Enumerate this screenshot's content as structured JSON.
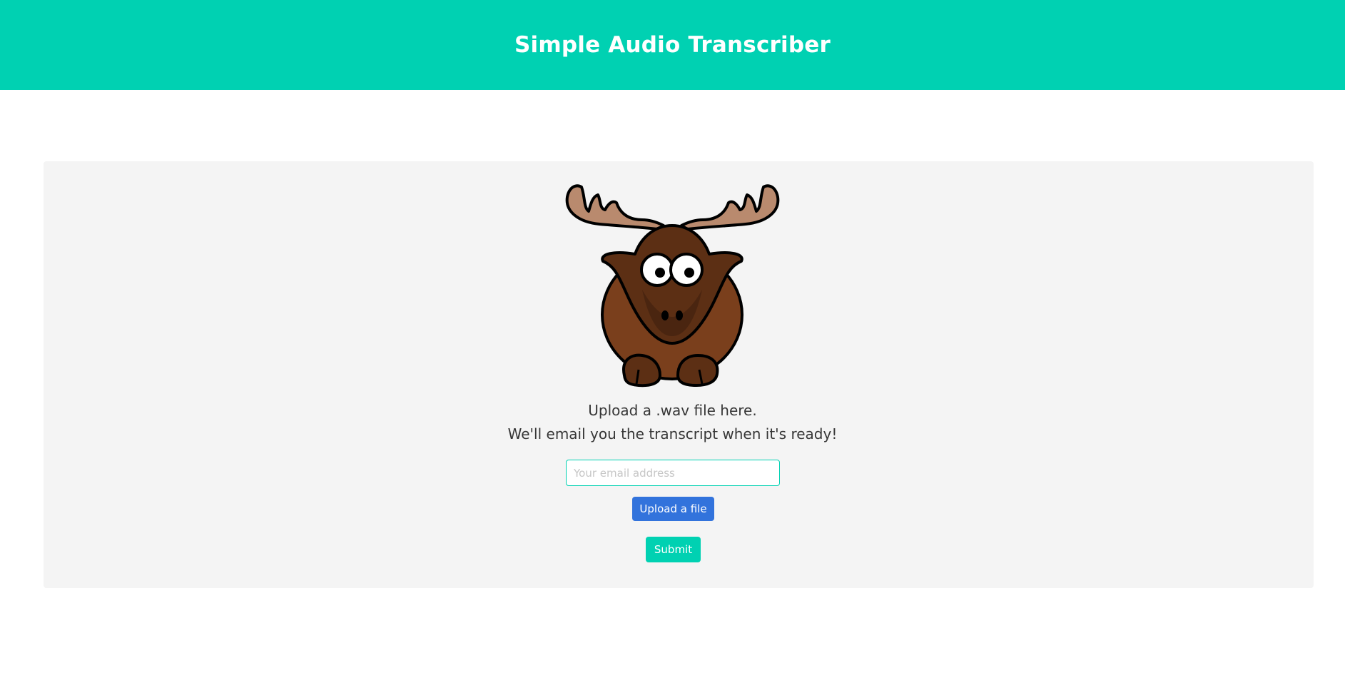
{
  "header": {
    "title": "Simple Audio Transcriber"
  },
  "mascot": {
    "icon": "moose-icon"
  },
  "intro": {
    "line1": "Upload a .wav file here.",
    "line2": "We'll email you the transcript when it's ready!"
  },
  "form": {
    "email_placeholder": "Your email address",
    "email_value": "",
    "upload_label": "Upload a file",
    "submit_label": "Submit"
  },
  "colors": {
    "primary": "#00d1b2",
    "link": "#3273dc",
    "panel": "#f4f4f4",
    "text": "#363636"
  }
}
